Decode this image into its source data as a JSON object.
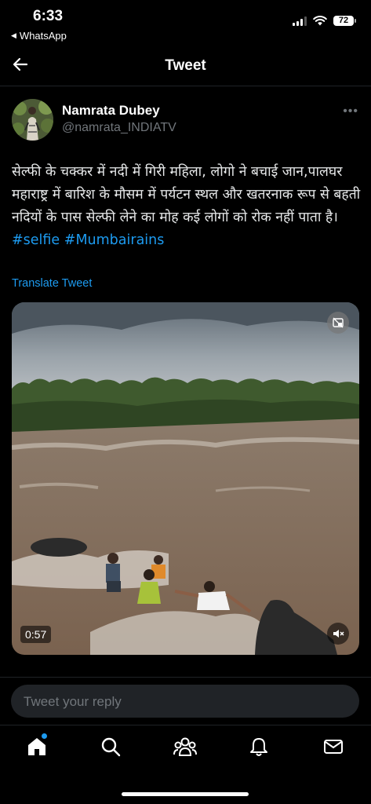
{
  "status_bar": {
    "time": "6:33",
    "back_app": "WhatsApp",
    "battery": "72"
  },
  "header": {
    "title": "Tweet",
    "back_icon": "back-arrow-icon"
  },
  "author": {
    "name": "Namrata Dubey",
    "handle": "@namrata_INDIATV",
    "more_icon": "more-icon"
  },
  "tweet": {
    "text": "सेल्फी के चक्कर में नदी में गिरी महिला, लोगो ने बचाई जान,पालघर महाराष्ट्र में बारिश के मौसम में पर्यटन स्थल और खतरनाक रूप से बहती नदियों के पास सेल्फी लेने का मोह कई लोगों को रोक नहीं पाता है। ",
    "hashtags": [
      "#selfie",
      "#Mumbairains"
    ],
    "translate_label": "Translate Tweet"
  },
  "video": {
    "duration": "0:57",
    "muted": true
  },
  "reply": {
    "placeholder": "Tweet your reply"
  },
  "tabbar": {
    "items": [
      "home-icon",
      "search-icon",
      "communities-icon",
      "notifications-icon",
      "messages-icon"
    ],
    "accent": "#1d9bf0"
  },
  "colors": {
    "background": "#000000",
    "link": "#1d9bf0",
    "secondary_text": "#71767b"
  }
}
